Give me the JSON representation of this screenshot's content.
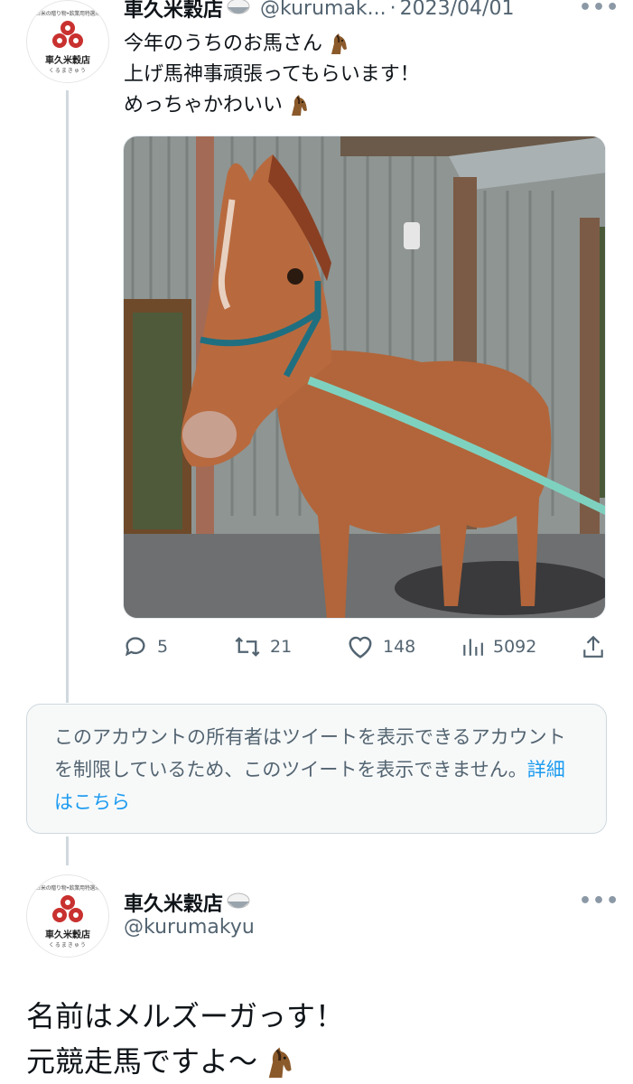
{
  "tweet": {
    "author_name": "車久米穀店",
    "handle": "@kurumak...",
    "separator": "·",
    "date": "2023/04/01",
    "more": "•••",
    "lines": [
      "今年のうちのお馬さん",
      "上げ馬神事頑張ってもらいます！",
      "めっちゃかわいい"
    ],
    "stats": {
      "replies": "5",
      "retweets": "21",
      "likes": "148",
      "views": "5092"
    }
  },
  "avatar": {
    "tagline": "お米の贈り物•飲業用特選米",
    "shop_name": "車久米穀店",
    "shop_kana": "くるまきゅう"
  },
  "notice": {
    "text": "このアカウントの所有者はツイートを表示できるアカウントを制限しているため、このツイートを表示できません。",
    "link": "詳細はこちら"
  },
  "reply": {
    "author_name": "車久米穀店",
    "handle": "@kurumakyu",
    "more": "•••",
    "lines": [
      "名前はメルズーガっす！",
      "元競走馬ですよ〜"
    ]
  },
  "colors": {
    "accent": "#1d9bf0",
    "muted": "#536471",
    "logo_red": "#c8312f"
  }
}
